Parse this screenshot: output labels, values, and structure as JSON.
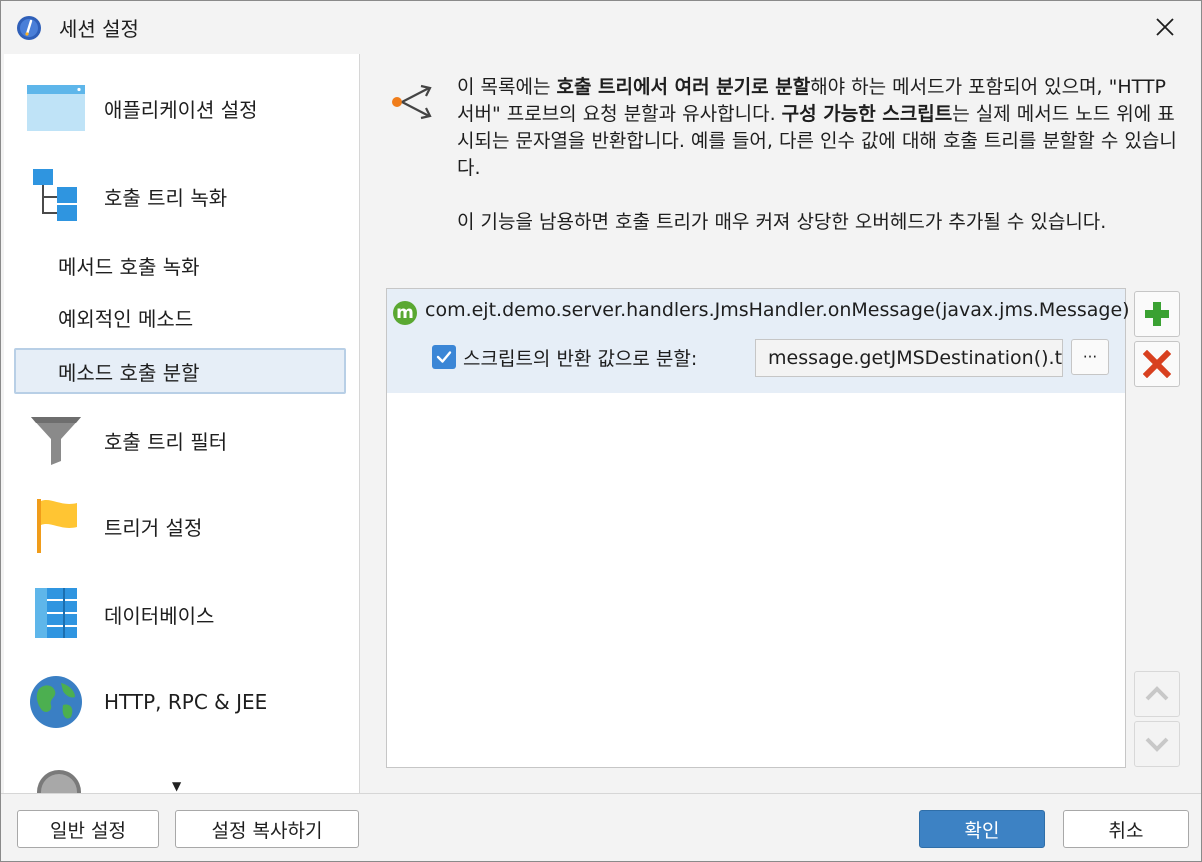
{
  "window": {
    "title": "세션 설정"
  },
  "sidebar": {
    "items": [
      {
        "label": "애플리케이션 설정",
        "icon": "application-window-icon"
      },
      {
        "label": "호출 트리 녹화",
        "icon": "call-tree-icon"
      },
      {
        "label": "호출 트리 필터",
        "icon": "funnel-icon"
      },
      {
        "label": "트리거 설정",
        "icon": "flag-icon"
      },
      {
        "label": "데이터베이스",
        "icon": "database-icon"
      },
      {
        "label": "HTTP, RPC & JEE",
        "icon": "globe-icon"
      }
    ],
    "sub_items": [
      {
        "label": "메서드 호출 녹화"
      },
      {
        "label": "예외적인 메소드"
      },
      {
        "label": "메소드 호출 분할",
        "selected": true
      }
    ]
  },
  "content": {
    "desc_para1_a": "이 목록에는 ",
    "desc_para1_b": "호출 트리에서 여러 분기로 분할",
    "desc_para1_c": "해야 하는 메서드가 포함되어 있으며, \"HTTP 서버\" 프로브의 요청 분할과 유사합니다. ",
    "desc_para1_d": "구성 가능한 스크립트",
    "desc_para1_e": "는 실제 메서드 노드 위에 표시되는 문자열을 반환합니다. 예를 들어, 다른 인수 값에 대해 호출 트리를 분할할 수 있습니다.",
    "desc_para2": "이 기능을 남용하면 호출 트리가 매우 커져 상당한 오버헤드가 추가될 수 있습니다.",
    "list": {
      "method": "com.ejt.demo.server.handlers.JmsHandler.onMessage(javax.jms.Message)",
      "method_badge": "m",
      "checkbox_label": "스크립트의 반환 값으로 분할:",
      "checkbox_checked": true,
      "script_value": "message.getJMSDestination().toString()",
      "dots_label": "···"
    }
  },
  "footer": {
    "general_settings": "일반 설정",
    "copy_settings": "설정 복사하기",
    "ok": "확인",
    "cancel": "취소"
  },
  "colors": {
    "accent": "#3d82c4",
    "selection": "#e6eef7",
    "add_green": "#3aa132",
    "remove_red": "#d8401f"
  }
}
